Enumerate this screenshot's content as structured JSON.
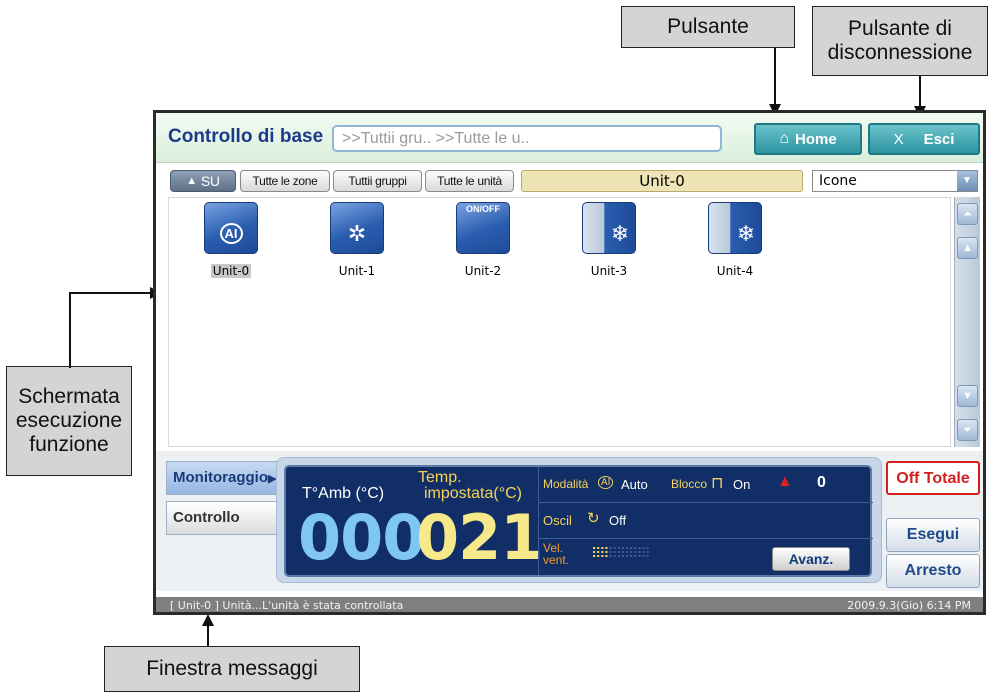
{
  "callouts": {
    "button": "Pulsante",
    "logout": "Pulsante di disconnessione",
    "screen": "Schermata esecuzione funzione",
    "messages": "Finestra messaggi"
  },
  "header": {
    "title": "Controllo di base",
    "breadcrumb": ">>Tuttii gru.. >>Tutte le u..",
    "home_label": "Home",
    "exit_x": "X",
    "exit_label": "Esci"
  },
  "nav": {
    "up_label": "SU",
    "all_zones": "Tutte le zone",
    "all_groups": "Tuttii gruppi",
    "all_units": "Tutte le unità",
    "current_unit": "Unit-0",
    "view_mode": "Icone"
  },
  "units": [
    {
      "label": "Unit-0",
      "icon": "ai-mode-icon",
      "selected": true
    },
    {
      "label": "Unit-1",
      "icon": "fan-icon"
    },
    {
      "label": "Unit-2",
      "icon": "onoff-icon",
      "badge": "ON/OFF"
    },
    {
      "label": "Unit-3",
      "icon": "snowflake-icon"
    },
    {
      "label": "Unit-4",
      "icon": "snowflake-icon"
    }
  ],
  "tabs": {
    "monitor": "Monitoraggio",
    "control": "Controllo"
  },
  "monitor": {
    "room_temp_label": "T°Amb (°C)",
    "set_temp_label_1": "Temp.",
    "set_temp_label_2": "impostata(°C)",
    "room_temp_value": "000",
    "set_temp_value": "021",
    "mode_label": "Modalità",
    "mode_value": "Auto",
    "lock_label": "Blocco",
    "lock_value": "On",
    "alarm_count": "0",
    "swing_label": "Oscil",
    "swing_value": "Off",
    "fan_label_1": "Vel.",
    "fan_label_2": "vent.",
    "advanced_label": "Avanz."
  },
  "actions": {
    "all_off": "Off Totale",
    "run": "Esegui",
    "stop": "Arresto"
  },
  "status": {
    "message": "[ Unit-0 ] Unità...L'unità è stata controllata",
    "datetime": "2009.9.3(Gio)  6:14 PM"
  },
  "colors": {
    "accent_blue": "#1c3a8a",
    "set_temp": "#f7e98a",
    "room_temp": "#7fc6f5",
    "alarm": "#e02020"
  }
}
